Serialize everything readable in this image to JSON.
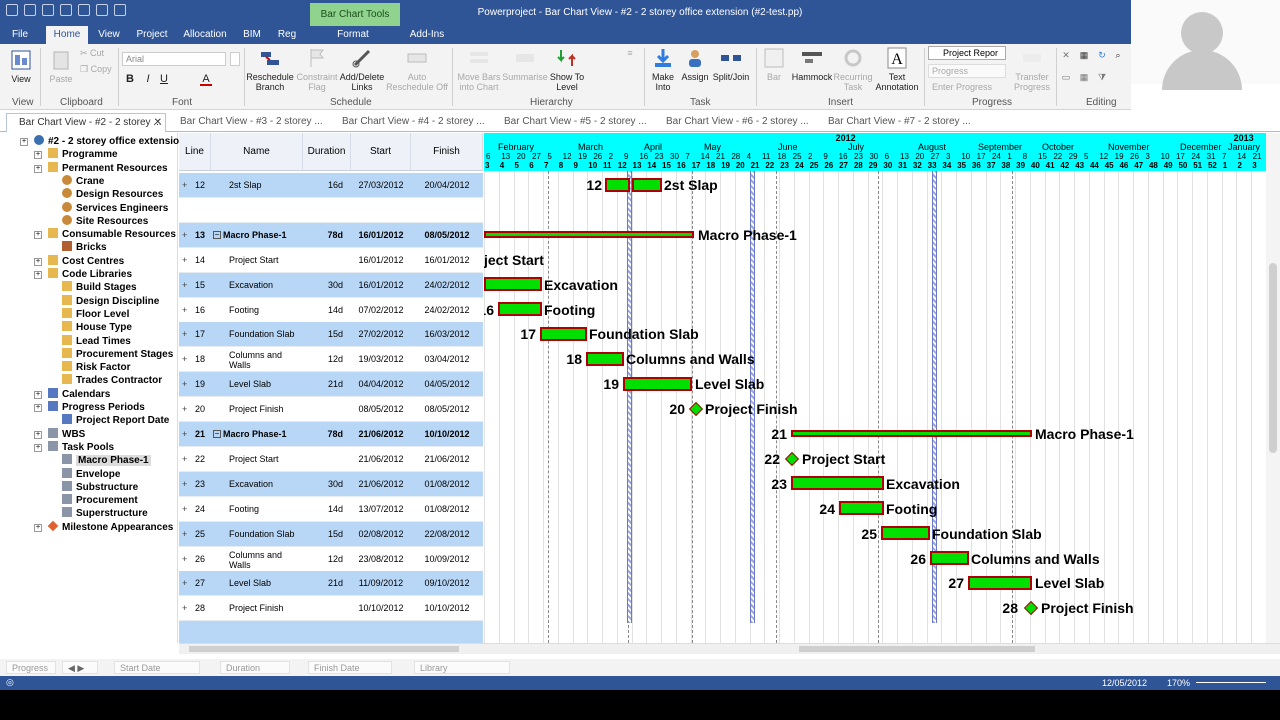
{
  "window": {
    "title": "Powerproject - Bar Chart View - #2 - 2 storey office extension   (#2-test.pp)",
    "context_tab": "Bar Chart Tools"
  },
  "menu_tabs": [
    "File",
    "Home",
    "View",
    "Project",
    "Allocation",
    "BIM",
    "Reg",
    "Format",
    "Add-Ins"
  ],
  "ribbon": {
    "view": {
      "label": "View",
      "group": "View"
    },
    "clipboard": {
      "paste": "Paste",
      "cut": "Cut",
      "copy": "Copy",
      "group": "Clipboard"
    },
    "font": {
      "family": "Arial",
      "bold": "B",
      "italic": "I",
      "underline": "U",
      "color": "A",
      "group": "Font"
    },
    "schedule": {
      "reschedule": "Reschedule",
      "reschedule2": "Branch",
      "constraint": "Constraint",
      "constraint2": "Flag",
      "links": "Add/Delete",
      "links2": "Links",
      "auto": "Auto",
      "auto2": "Reschedule Off",
      "group": "Schedule"
    },
    "hierarchy": {
      "move": "Move Bars",
      "move2": "into Chart",
      "summarise": "Summarise",
      "show": "Show To",
      "show2": "Level",
      "group": "Hierarchy"
    },
    "task": {
      "make": "Make",
      "make2": "Into",
      "assign": "Assign",
      "split": "Split/Join",
      "group": "Task"
    },
    "insert": {
      "bar": "Bar",
      "hammock": "Hammock",
      "recurring": "Recurring",
      "recurring2": "Task",
      "text": "Text",
      "text2": "Annotation",
      "group": "Insert"
    },
    "progress": {
      "select": "Project Repor",
      "field": "Progress",
      "enter": "Enter Progress",
      "transfer": "Transfer",
      "transfer2": "Progress",
      "group": "Progress"
    },
    "editing": {
      "group": "Editing"
    }
  },
  "doc_tabs": [
    "Bar Chart View - #2 - 2 storey ...",
    "Bar Chart View - #3 - 2 storey ...",
    "Bar Chart View - #4 - 2 storey ...",
    "Bar Chart View - #5 - 2 storey ...",
    "Bar Chart View - #6 - 2 storey ...",
    "Bar Chart View - #7 - 2 storey ..."
  ],
  "tree": [
    {
      "label": "#2 - 2 storey office extension",
      "level": 0,
      "icon": "globe"
    },
    {
      "label": "Programme",
      "level": 1,
      "icon": "folder"
    },
    {
      "label": "Permanent Resources",
      "level": 1,
      "icon": "folder"
    },
    {
      "label": "Crane",
      "level": 2,
      "icon": "person"
    },
    {
      "label": "Design Resources",
      "level": 2,
      "icon": "person"
    },
    {
      "label": "Services Engineers",
      "level": 2,
      "icon": "person"
    },
    {
      "label": "Site Resources",
      "level": 2,
      "icon": "person"
    },
    {
      "label": "Consumable Resources",
      "level": 1,
      "icon": "folder"
    },
    {
      "label": "Bricks",
      "level": 2,
      "icon": "brick"
    },
    {
      "label": "Cost Centres",
      "level": 1,
      "icon": "folder"
    },
    {
      "label": "Code Libraries",
      "level": 1,
      "icon": "folder"
    },
    {
      "label": "Build Stages",
      "level": 2,
      "icon": "folder"
    },
    {
      "label": "Design Discipline",
      "level": 2,
      "icon": "folder"
    },
    {
      "label": "Floor Level",
      "level": 2,
      "icon": "folder"
    },
    {
      "label": "House Type",
      "level": 2,
      "icon": "folder"
    },
    {
      "label": "Lead Times",
      "level": 2,
      "icon": "folder"
    },
    {
      "label": "Procurement Stages",
      "level": 2,
      "icon": "folder"
    },
    {
      "label": "Risk Factor",
      "level": 2,
      "icon": "folder"
    },
    {
      "label": "Trades Contractor",
      "level": 2,
      "icon": "folder"
    },
    {
      "label": "Calendars",
      "level": 1,
      "icon": "calendar"
    },
    {
      "label": "Progress Periods",
      "level": 1,
      "icon": "calendar"
    },
    {
      "label": "Project Report Date",
      "level": 2,
      "icon": "calendar"
    },
    {
      "label": "WBS",
      "level": 1,
      "icon": "doc"
    },
    {
      "label": "Task Pools",
      "level": 1,
      "icon": "doc"
    },
    {
      "label": "Macro Phase-1",
      "level": 2,
      "icon": "doc",
      "selected": true
    },
    {
      "label": "Envelope",
      "level": 2,
      "icon": "doc"
    },
    {
      "label": "Substructure",
      "level": 2,
      "icon": "doc"
    },
    {
      "label": "Procurement",
      "level": 2,
      "icon": "doc"
    },
    {
      "label": "Superstructure",
      "level": 2,
      "icon": "doc"
    },
    {
      "label": "Milestone Appearances",
      "level": 1,
      "icon": "diamond"
    }
  ],
  "columns": {
    "line": "Line",
    "name": "Name",
    "duration": "Duration",
    "start": "Start",
    "finish": "Finish"
  },
  "rows": [
    {
      "line": "12",
      "name": "2st Slap",
      "duration": "16d",
      "start": "27/03/2012",
      "finish": "20/04/2012",
      "hl": true
    },
    {
      "line": "",
      "name": "",
      "duration": "",
      "start": "",
      "finish": "",
      "hl": false
    },
    {
      "line": "13",
      "name": "Macro Phase-1",
      "duration": "78d",
      "start": "16/01/2012",
      "finish": "08/05/2012",
      "hl": true,
      "summary": true
    },
    {
      "line": "14",
      "name": "Project Start",
      "duration": "",
      "start": "16/01/2012",
      "finish": "16/01/2012",
      "hl": false
    },
    {
      "line": "15",
      "name": "Excavation",
      "duration": "30d",
      "start": "16/01/2012",
      "finish": "24/02/2012",
      "hl": true
    },
    {
      "line": "16",
      "name": "Footing",
      "duration": "14d",
      "start": "07/02/2012",
      "finish": "24/02/2012",
      "hl": false
    },
    {
      "line": "17",
      "name": "Foundation Slab",
      "duration": "15d",
      "start": "27/02/2012",
      "finish": "16/03/2012",
      "hl": true
    },
    {
      "line": "18",
      "name": "Columns and Walls",
      "duration": "12d",
      "start": "19/03/2012",
      "finish": "03/04/2012",
      "hl": false
    },
    {
      "line": "19",
      "name": "Level Slab",
      "duration": "21d",
      "start": "04/04/2012",
      "finish": "04/05/2012",
      "hl": true
    },
    {
      "line": "20",
      "name": "Project Finish",
      "duration": "",
      "start": "08/05/2012",
      "finish": "08/05/2012",
      "hl": false
    },
    {
      "line": "21",
      "name": "Macro Phase-1",
      "duration": "78d",
      "start": "21/06/2012",
      "finish": "10/10/2012",
      "hl": true,
      "summary": true
    },
    {
      "line": "22",
      "name": "Project Start",
      "duration": "",
      "start": "21/06/2012",
      "finish": "21/06/2012",
      "hl": false
    },
    {
      "line": "23",
      "name": "Excavation",
      "duration": "30d",
      "start": "21/06/2012",
      "finish": "01/08/2012",
      "hl": true
    },
    {
      "line": "24",
      "name": "Footing",
      "duration": "14d",
      "start": "13/07/2012",
      "finish": "01/08/2012",
      "hl": false
    },
    {
      "line": "25",
      "name": "Foundation Slab",
      "duration": "15d",
      "start": "02/08/2012",
      "finish": "22/08/2012",
      "hl": true
    },
    {
      "line": "26",
      "name": "Columns and Walls",
      "duration": "12d",
      "start": "23/08/2012",
      "finish": "10/09/2012",
      "hl": false
    },
    {
      "line": "27",
      "name": "Level Slab",
      "duration": "21d",
      "start": "11/09/2012",
      "finish": "09/10/2012",
      "hl": true
    },
    {
      "line": "28",
      "name": "Project Finish",
      "duration": "",
      "start": "10/10/2012",
      "finish": "10/10/2012",
      "hl": false
    },
    {
      "line": "",
      "name": "",
      "duration": "",
      "start": "",
      "finish": "",
      "hl": true
    }
  ],
  "timeline": {
    "years": [
      {
        "label": "2012",
        "at": 0.465
      },
      {
        "label": "2013",
        "at": 0.974
      }
    ],
    "months": [
      "February",
      "March",
      "April",
      "May",
      "June",
      "July",
      "August",
      "September",
      "October",
      "November",
      "December",
      "January"
    ],
    "days": [
      "6",
      "13",
      "20",
      "27",
      "5",
      "12",
      "19",
      "26",
      "2",
      "9",
      "16",
      "23",
      "30",
      "7",
      "14",
      "21",
      "28",
      "4",
      "11",
      "18",
      "25",
      "2",
      "9",
      "16",
      "23",
      "30",
      "6",
      "13",
      "20",
      "27",
      "3",
      "10",
      "17",
      "24",
      "1",
      "8",
      "15",
      "22",
      "29",
      "5",
      "12",
      "19",
      "26",
      "3",
      "10",
      "17",
      "24",
      "31",
      "7",
      "14",
      "21"
    ],
    "weeks": [
      "3",
      "4",
      "5",
      "6",
      "7",
      "8",
      "9",
      "10",
      "11",
      "12",
      "13",
      "14",
      "15",
      "16",
      "17",
      "18",
      "19",
      "20",
      "21",
      "22",
      "23",
      "24",
      "25",
      "26",
      "27",
      "28",
      "29",
      "30",
      "31",
      "32",
      "33",
      "34",
      "35",
      "36",
      "37",
      "38",
      "39",
      "40",
      "41",
      "42",
      "43",
      "44",
      "45",
      "46",
      "47",
      "48",
      "49",
      "50",
      "51",
      "52",
      "1",
      "2",
      "3"
    ]
  },
  "bar_labels": {
    "r12": "2st Slap",
    "r13": "Macro Phase-1",
    "r14": "ject Start",
    "r15": "Excavation",
    "r16": "Footing",
    "r17": "Foundation Slab",
    "r18": "Columns and Walls",
    "r19": "Level Slab",
    "r20": "Project Finish",
    "r21": "Macro Phase-1",
    "r22": "Project Start",
    "r23": "Excavation",
    "r24": "Footing",
    "r25": "Foundation Slab",
    "r26": "Columns and Walls",
    "r27": "Level Slab",
    "r28": "Project Finish"
  },
  "footer": {
    "progress": "Progress",
    "start": "Start Date",
    "duration": "Duration",
    "finish": "Finish Date",
    "library": "Library"
  },
  "status": {
    "date": "12/05/2012",
    "zoom": "170%"
  }
}
